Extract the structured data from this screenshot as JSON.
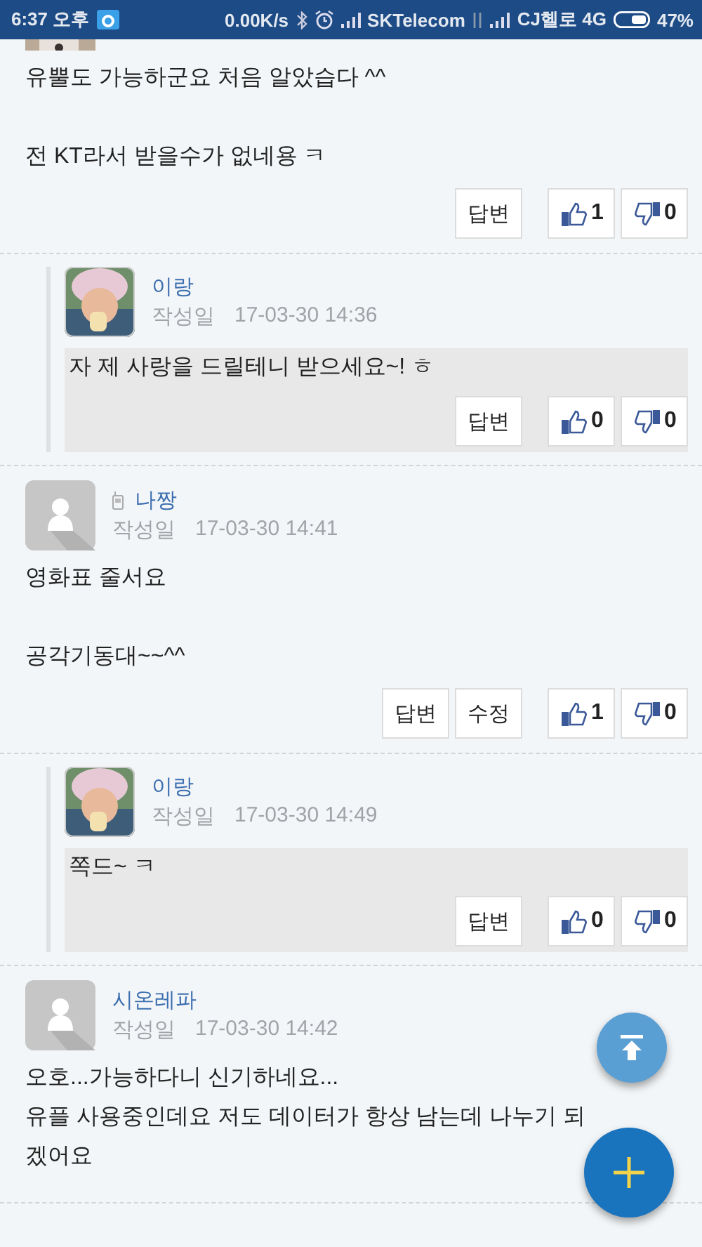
{
  "status_bar": {
    "time": "6:37 오후",
    "speed": "0.00K/s",
    "carrier_1": "SKTelecom",
    "carrier_2": "CJ헬로 4G",
    "battery": "47%"
  },
  "partial_avatar": {
    "kind": "picture"
  },
  "comments": [
    {
      "kind": "comment",
      "paragraphs": [
        [
          "유뿔도 가능하군요 처음 알았습다 ^^"
        ],
        [
          "전 KT라서 받을수가 없네용 ㅋ"
        ]
      ],
      "buttons": [
        "답변"
      ],
      "likes": "1",
      "dislikes": "0"
    },
    {
      "kind": "reply",
      "avatar": {
        "kind": "picture"
      },
      "author": "이랑",
      "mobile": false,
      "date_label": "작성일",
      "date": "17-03-30 14:36",
      "paragraphs": [
        [
          "자 제 사랑을 드릴테니 받으세요~! ㅎ"
        ]
      ],
      "buttons": [
        "답변"
      ],
      "likes": "0",
      "dislikes": "0"
    },
    {
      "kind": "comment",
      "avatar": {
        "kind": "icon"
      },
      "author": "나짱",
      "mobile": true,
      "date_label": "작성일",
      "date": "17-03-30 14:41",
      "paragraphs": [
        [
          "영화표 줄서요"
        ],
        [
          "공각기동대~~^^"
        ]
      ],
      "buttons": [
        "답변",
        "수정"
      ],
      "likes": "1",
      "dislikes": "0"
    },
    {
      "kind": "reply",
      "avatar": {
        "kind": "picture"
      },
      "author": "이랑",
      "mobile": false,
      "date_label": "작성일",
      "date": "17-03-30 14:49",
      "paragraphs": [
        [
          "쪽드~ ㅋ"
        ]
      ],
      "buttons": [
        "답변"
      ],
      "likes": "0",
      "dislikes": "0"
    },
    {
      "kind": "comment",
      "avatar": {
        "kind": "icon"
      },
      "author": "시온레파",
      "mobile": false,
      "date_label": "작성일",
      "date": "17-03-30 14:42",
      "paragraphs": [
        [
          "오호...가능하다니 신기하네요...",
          "유플 사용중인데요 저도 데이터가 항상 남는데 나누기 되",
          "겠어요"
        ]
      ]
    }
  ]
}
